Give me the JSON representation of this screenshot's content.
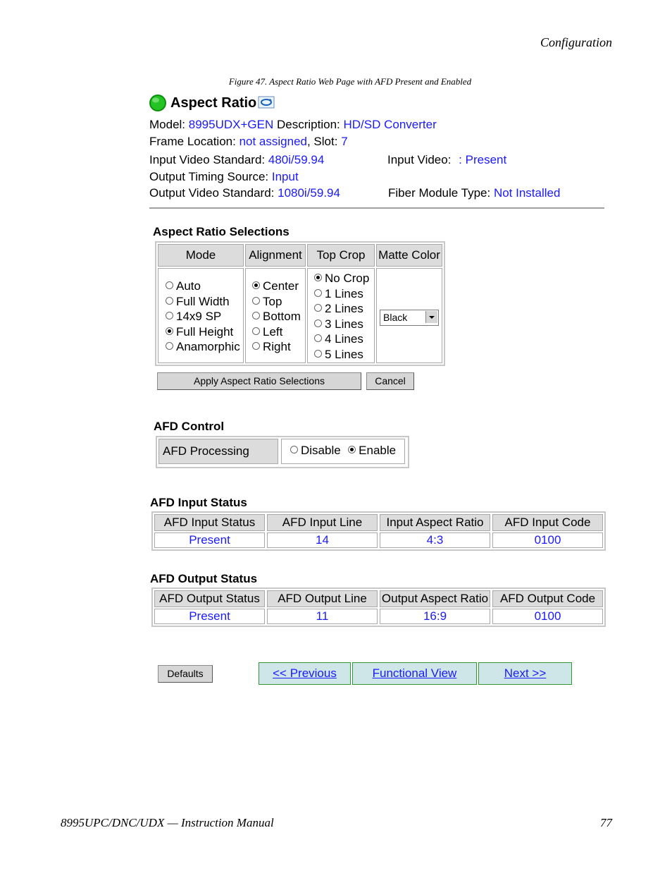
{
  "header": {
    "section": "Configuration"
  },
  "figure_caption": "Figure 47.  Aspect Ratio Web Page with AFD Present and Enabled",
  "page": {
    "title": "Aspect Ratio",
    "model_label": "Model:",
    "model_value": "8995UDX+GEN",
    "description_label": "Description:",
    "description_value": "HD/SD Converter",
    "frame_location_label": "Frame Location:",
    "frame_location_value": "not assigned",
    "slot_label": ", Slot:",
    "slot_value": "7",
    "input_std_label": "Input Video Standard:",
    "input_std_value": "480i/59.94",
    "input_video_label": "Input Video:",
    "input_video_value": ": Present",
    "timing_label": "Output Timing Source:",
    "timing_value": "Input",
    "output_std_label": "Output Video Standard:",
    "output_std_value": "1080i/59.94",
    "fiber_label": "Fiber Module Type:",
    "fiber_value": "Not Installed"
  },
  "aspect_selections": {
    "title": "Aspect Ratio Selections",
    "columns": [
      "Mode",
      "Alignment",
      "Top Crop",
      "Matte Color"
    ],
    "mode_options": [
      "Auto",
      "Full Width",
      "14x9 SP",
      "Full Height",
      "Anamorphic"
    ],
    "mode_selected": "Full Height",
    "alignment_options": [
      "Center",
      "Top",
      "Bottom",
      "Left",
      "Right"
    ],
    "alignment_selected": "Center",
    "crop_options": [
      "No Crop",
      "1 Lines",
      "2 Lines",
      "3 Lines",
      "4 Lines",
      "5 Lines"
    ],
    "crop_selected": "No Crop",
    "matte_value": "Black",
    "apply_label": "Apply Aspect Ratio Selections",
    "cancel_label": "Cancel"
  },
  "afd_control": {
    "title": "AFD Control",
    "label": "AFD Processing",
    "options": [
      "Disable",
      "Enable"
    ],
    "selected": "Enable"
  },
  "afd_input": {
    "title": "AFD Input Status",
    "headers": [
      "AFD Input Status",
      "AFD Input Line",
      "Input Aspect Ratio",
      "AFD Input Code"
    ],
    "values": [
      "Present",
      "14",
      "4:3",
      "0100"
    ]
  },
  "afd_output": {
    "title": "AFD Output Status",
    "headers": [
      "AFD Output Status",
      "AFD Output Line",
      "Output Aspect Ratio",
      "AFD Output Code"
    ],
    "values": [
      "Present",
      "11",
      "16:9",
      "0100"
    ]
  },
  "nav": {
    "defaults_label": "Defaults",
    "previous_label": "<< Previous",
    "functional_label": "Functional View",
    "next_label": "Next >>"
  },
  "footer": {
    "manual": "8995UPC/DNC/UDX — Instruction Manual",
    "page_number": "77"
  },
  "colors": {
    "link_blue": "#1a1aff",
    "status_green": "#22c322",
    "nav_border": "#2f9a2f"
  }
}
